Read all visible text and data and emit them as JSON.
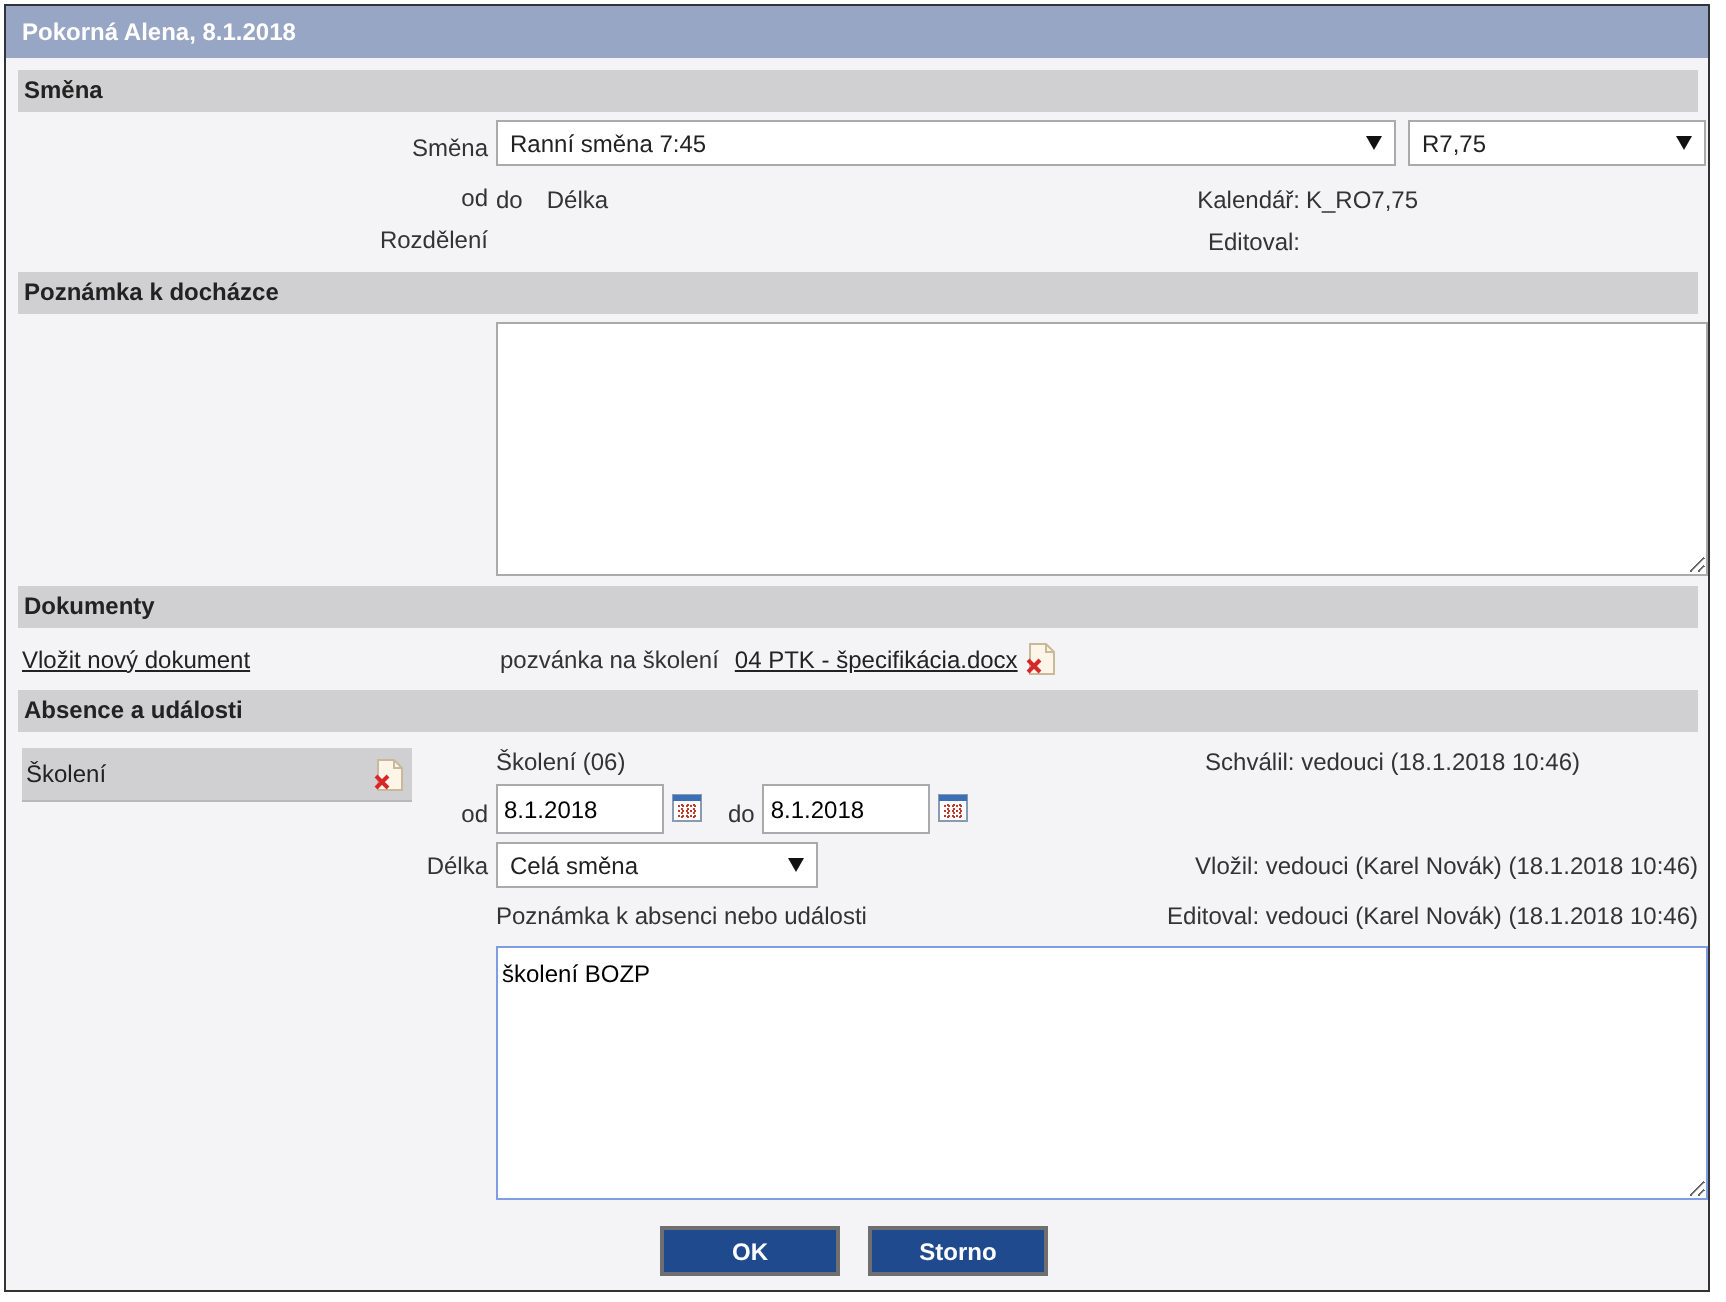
{
  "window": {
    "title": "Pokorná Alena, 8.1.2018"
  },
  "shift_section": {
    "heading": "Směna",
    "shift_label": "Směna",
    "shift_select": "Ranní směna 7:45",
    "variant_select": "R7,75",
    "from_label": "od",
    "to_label": "do",
    "length_label": "Délka",
    "calendar_label": "Kalendář:",
    "calendar_value": "K_RO7,75",
    "split_label": "Rozdělení",
    "edited_label": "Editoval:"
  },
  "note_section": {
    "heading": "Poznámka k docházce"
  },
  "documents": {
    "heading": "Dokumenty",
    "add_link": "Vložit nový dokument",
    "doc_label": "pozvánka na školení",
    "doc_link": "04 PTK - špecifikácia.docx"
  },
  "absences": {
    "heading": "Absence a události",
    "items": [
      {
        "label": "Školení",
        "selected": true
      }
    ],
    "type": "Školení (06)",
    "approved": "Schválil: vedouci (18.1.2018 10:46)",
    "from_label": "od",
    "from_value": "8.1.2018",
    "to_label": "do",
    "to_value": "8.1.2018",
    "length_label": "Délka",
    "length_select": "Celá směna",
    "inserted": "Vložil: vedouci (Karel Novák) (18.1.2018 10:46)",
    "note_label": "Poznámka k absenci nebo události",
    "edited": "Editoval: vedouci (Karel Novák) (18.1.2018 10:46)",
    "note_value": "školení BOZP"
  },
  "buttons": [
    "OK",
    "Storno"
  ]
}
